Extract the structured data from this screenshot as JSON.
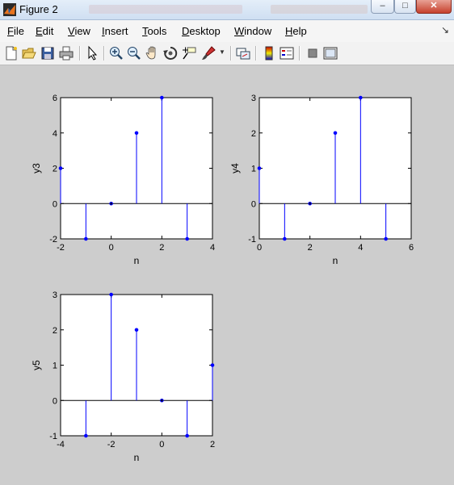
{
  "window": {
    "title": "Figure 2"
  },
  "menu": [
    {
      "key": "F",
      "rest": "ile"
    },
    {
      "key": "E",
      "rest": "dit"
    },
    {
      "key": "V",
      "rest": "iew"
    },
    {
      "key": "I",
      "rest": "nsert"
    },
    {
      "key": "T",
      "rest": "ools"
    },
    {
      "key": "D",
      "rest": "esktop"
    },
    {
      "key": "W",
      "rest": "indow"
    },
    {
      "key": "H",
      "rest": "elp"
    }
  ],
  "toolbar_icons": [
    "new-figure-icon",
    "open-file-icon",
    "save-icon",
    "print-icon",
    "edit-plot-arrow-icon",
    "zoom-in-icon",
    "zoom-out-icon",
    "pan-hand-icon",
    "rotate-3d-icon",
    "data-cursor-icon",
    "brush-icon",
    "link-plot-icon",
    "colorbar-icon",
    "legend-icon",
    "hide-plot-tools-icon",
    "show-plot-tools-icon"
  ],
  "colors": {
    "stem": "#0000ff",
    "baseline": "#000000",
    "axes_bg": "#ffffff",
    "figure_bg": "#cdcdcd"
  },
  "chart_data": [
    {
      "type": "stem",
      "xlabel": "n",
      "ylabel": "y3",
      "xlim": [
        -2,
        4
      ],
      "ylim": [
        -2,
        6
      ],
      "xticks": [
        -2,
        0,
        2,
        4
      ],
      "yticks": [
        -2,
        0,
        2,
        4,
        6
      ],
      "x": [
        -2,
        -1,
        0,
        1,
        2,
        3
      ],
      "y": [
        2,
        -2,
        0,
        4,
        6,
        -2
      ]
    },
    {
      "type": "stem",
      "xlabel": "n",
      "ylabel": "y4",
      "xlim": [
        0,
        6
      ],
      "ylim": [
        -1,
        3
      ],
      "xticks": [
        0,
        2,
        4,
        6
      ],
      "yticks": [
        -1,
        0,
        1,
        2,
        3
      ],
      "x": [
        0,
        1,
        2,
        3,
        4,
        5
      ],
      "y": [
        1,
        -1,
        0,
        2,
        3,
        -1
      ]
    },
    {
      "type": "stem",
      "xlabel": "n",
      "ylabel": "y5",
      "xlim": [
        -4,
        2
      ],
      "ylim": [
        -1,
        3
      ],
      "xticks": [
        -4,
        -2,
        0,
        2
      ],
      "yticks": [
        -1,
        0,
        1,
        2,
        3
      ],
      "x": [
        -3,
        -2,
        -1,
        0,
        1,
        2
      ],
      "y": [
        -1,
        3,
        2,
        0,
        -1,
        1
      ]
    }
  ]
}
